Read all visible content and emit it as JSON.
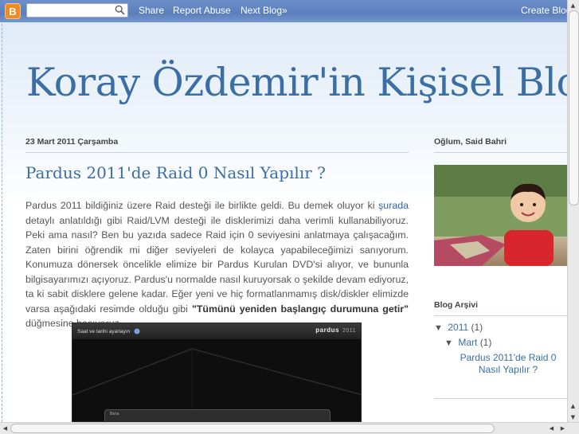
{
  "navbar": {
    "logo_letter": "B",
    "search_placeholder": "",
    "share": "Share",
    "report_abuse": "Report Abuse",
    "next_blog": "Next Blog»",
    "create_blog": "Create Blog"
  },
  "blog": {
    "title": "Koray Özdemir'in Kişisel Blog"
  },
  "post": {
    "date": "23 Mart 2011 Çarşamba",
    "title": "Pardus 2011'de Raid 0 Nasıl Yapılır ?",
    "body_1": "Pardus 2011 bildiğiniz üzere Raid desteği ile birlikte geldi. Bu demek oluyor ki ",
    "link": "şurada",
    "body_2": " detaylı anlatıldığı gibi Raid/LVM desteği ile disklerimizi daha verimli kullanabiliyoruz. Peki ama nasıl? Ben bu yazıda sadece Raid için 0 seviyesini anlatmaya çalışacağım. Zaten birini öğrendik mi diğer seviyeleri de kolayca yapabileceğimizi sanıyorum. Konumuza dönersek öncelikle elimize bir Pardus Kurulan DVD'si alıyor, ve bununla bilgisayarımızı açıyoruz. Pardus'u normalde nasıl kuruyorsak o şekilde devam ediyoruz, ta ki sabit disklere gelene kadar. Eğer yeni ve hiç formatlanmamış disk/diskler elimizde varsa aşağıdaki resimde olduğu gibi ",
    "bold": "\"Tümünü yeniden başlangıç durumuna getir\"",
    "body_3": " düğmesine basıyoruz.",
    "screenshot": {
      "window_title": "Saat ve tarihi ayarlayın",
      "brand": "pardus",
      "version": "2011",
      "panel_label": "Beta"
    }
  },
  "sidebar": {
    "photo_title": "Oğlum, Said Bahri",
    "archive_title": "Blog Arşivi",
    "archive": {
      "year": "2011",
      "year_count": "(1)",
      "month": "Mart",
      "month_count": "(1)",
      "post_link_line1": "Pardus 2011'de Raid 0",
      "post_link_line2": "Nasıl Yapılır ?"
    }
  }
}
